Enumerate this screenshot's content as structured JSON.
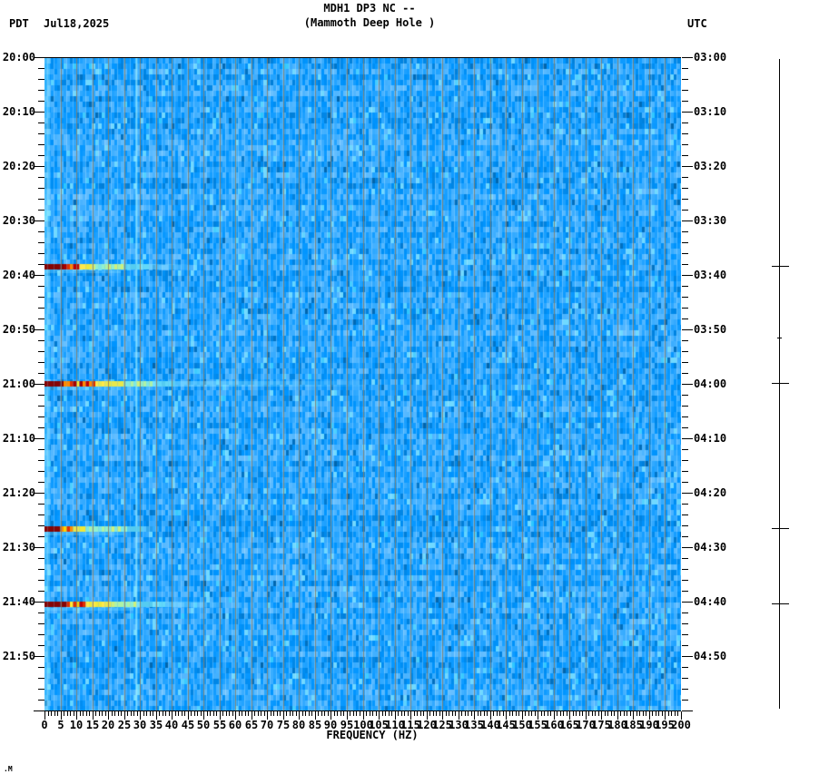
{
  "header": {
    "title": "MDH1 DP3 NC --",
    "subtitle": "(Mammoth Deep Hole )",
    "tz_left": "PDT",
    "date": "Jul18,2025",
    "tz_right": "UTC"
  },
  "left_axis": {
    "ticks": [
      "20:00",
      "20:10",
      "20:20",
      "20:30",
      "20:40",
      "20:50",
      "21:00",
      "21:10",
      "21:20",
      "21:30",
      "21:40",
      "21:50"
    ]
  },
  "right_axis": {
    "ticks": [
      "03:00",
      "03:10",
      "03:20",
      "03:30",
      "03:40",
      "03:50",
      "04:00",
      "04:10",
      "04:20",
      "04:30",
      "04:40",
      "04:50"
    ]
  },
  "x_axis": {
    "label": "FREQUENCY (HZ)",
    "ticks": [
      "0",
      "5",
      "10",
      "15",
      "20",
      "25",
      "30",
      "35",
      "40",
      "45",
      "50",
      "55",
      "60",
      "65",
      "70",
      "75",
      "80",
      "85",
      "90",
      "95",
      "100",
      "105",
      "110",
      "115",
      "120",
      "125",
      "130",
      "135",
      "140",
      "145",
      "150",
      "155",
      "160",
      "165",
      "170",
      "175",
      "180",
      "185",
      "190",
      "195",
      "200"
    ]
  },
  "footer": {
    "mark": ".M"
  },
  "chart_data": {
    "type": "heatmap",
    "title": "MDH1 DP3 NC --",
    "subtitle": "(Mammoth Deep Hole )",
    "station": "MDH1 DP3 NC",
    "site_name": "Mammoth Deep Hole",
    "date_pdt": "Jul18,2025",
    "xlabel": "FREQUENCY (HZ)",
    "x_range_hz": [
      0,
      200
    ],
    "x_major_tick_step_hz": 5,
    "x_minor_tick_step_hz": 1,
    "grid_every_hz": 5,
    "time_axis_left": {
      "timezone": "PDT",
      "start": "20:00",
      "end": "22:00",
      "major_tick_minutes": 10,
      "minor_tick_minutes": 2
    },
    "time_axis_right": {
      "timezone": "UTC",
      "start": "03:00",
      "end": "05:00",
      "major_tick_minutes": 10,
      "minor_tick_minutes": 2
    },
    "background": "random blue noise mosaic (ambient seismic noise)",
    "persistent_tones_hz": [
      1,
      29,
      60
    ],
    "events": [
      {
        "time_pdt": "20:38",
        "time_utc": "03:38",
        "minute_offset": 38.4,
        "extent_hz": [
          5.0,
          10.5,
          14,
          24,
          32,
          45
        ]
      },
      {
        "time_pdt": "21:00",
        "time_utc": "04:00",
        "minute_offset": 59.8,
        "extent_hz": [
          5.4,
          15.7,
          24,
          33,
          40,
          100
        ]
      },
      {
        "time_pdt": "21:26",
        "time_utc": "04:26",
        "minute_offset": 86.5,
        "extent_hz": [
          4.0,
          8.5,
          12,
          25,
          30,
          35
        ]
      },
      {
        "time_pdt": "21:40",
        "time_utc": "04:40",
        "minute_offset": 100.3,
        "extent_hz": [
          6.5,
          12.0,
          20,
          28,
          37,
          55
        ]
      }
    ],
    "trace_minor_blip_minute": 51.5,
    "colormap": {
      "background_blues": [
        "#0060d0",
        "#0084ff",
        "#009cff",
        "#28b8ff",
        "#55d4ff"
      ],
      "event_scale": [
        "#850505",
        "#c40000",
        "#f03800",
        "#ff8c00",
        "#ffd400",
        "#ece840",
        "#c2f07c",
        "#96f2c8",
        "#6fdcf5"
      ],
      "gridline": "#887c64"
    },
    "legend": "none"
  }
}
